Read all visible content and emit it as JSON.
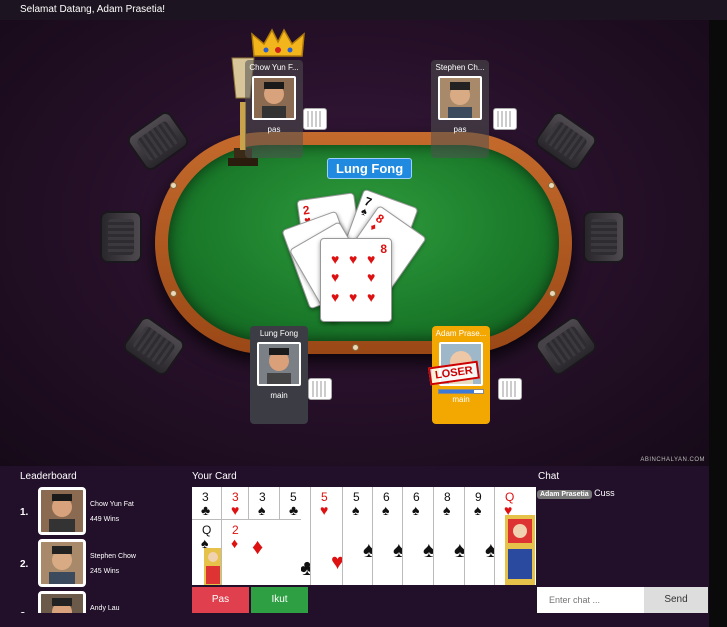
{
  "header": {
    "welcome": "Selamat Datang, Adam Prasetia!"
  },
  "table": {
    "turn_label": "Lung Fong",
    "watermark": "ABINCHALYAN.COM",
    "played_cards": [
      {
        "rank": "2",
        "suit": "♥",
        "color": "red"
      },
      {
        "rank": "7",
        "suit": "♠",
        "color": "black"
      },
      {
        "rank": "8",
        "suit": "♦",
        "color": "red"
      },
      {
        "rank": "8",
        "suit": "♥",
        "color": "red"
      }
    ]
  },
  "players": [
    {
      "name": "Chow Yun F...",
      "status": "pas",
      "role": "crowned"
    },
    {
      "name": "Stephen Ch...",
      "status": "pas",
      "role": "opponent"
    },
    {
      "name": "Lung Fong",
      "status": "main",
      "role": "current"
    },
    {
      "name": "Adam Prase...",
      "status": "main",
      "role": "you",
      "badge": "LOSER"
    }
  ],
  "leaderboard": {
    "title": "Leaderboard",
    "entries": [
      {
        "rank": "1.",
        "name": "Chow Yun Fat",
        "wins": "449 Wins"
      },
      {
        "rank": "2.",
        "name": "Stephen Chow",
        "wins": "245 Wins"
      },
      {
        "rank": "3.",
        "name": "Andy Lau",
        "wins": ""
      }
    ]
  },
  "hand": {
    "title": "Your Card",
    "row1": [
      {
        "rank": "3",
        "suit": "♣",
        "color": "black"
      },
      {
        "rank": "3",
        "suit": "♥",
        "color": "red"
      },
      {
        "rank": "3",
        "suit": "♠",
        "color": "black"
      },
      {
        "rank": "5",
        "suit": "♣",
        "color": "black"
      },
      {
        "rank": "5",
        "suit": "♥",
        "color": "red"
      },
      {
        "rank": "5",
        "suit": "♠",
        "color": "black"
      },
      {
        "rank": "6",
        "suit": "♠",
        "color": "black"
      },
      {
        "rank": "6",
        "suit": "♠",
        "color": "black"
      },
      {
        "rank": "8",
        "suit": "♠",
        "color": "black"
      },
      {
        "rank": "9",
        "suit": "♠",
        "color": "black"
      },
      {
        "rank": "Q",
        "suit": "♥",
        "color": "red"
      }
    ],
    "row2": [
      {
        "rank": "Q",
        "suit": "♠",
        "color": "black"
      },
      {
        "rank": "2",
        "suit": "♦",
        "color": "red"
      }
    ]
  },
  "actions": {
    "pass_label": "Pas",
    "follow_label": "Ikut"
  },
  "chat": {
    "title": "Chat",
    "messages": [
      {
        "user": "Adam Prasetia",
        "text": "Cuss"
      }
    ],
    "input_placeholder": "Enter chat ...",
    "send_label": "Send"
  },
  "colors": {
    "pass_button": "#e0404e",
    "follow_button": "#2ea043",
    "turn_label": "#1f8ae0",
    "you_badge": "#f2a800"
  }
}
